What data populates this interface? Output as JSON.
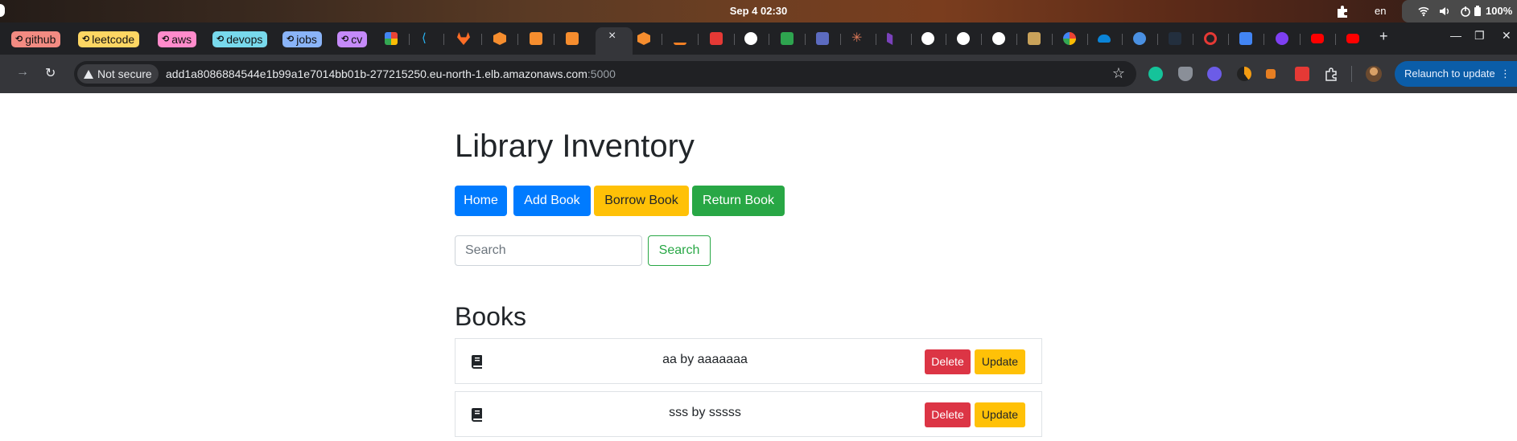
{
  "os": {
    "clock": "Sep 4  02:30",
    "lang": "en",
    "battery": "100%"
  },
  "tabs": {
    "groups": [
      {
        "label": "github",
        "color": "#f28b82"
      },
      {
        "label": "leetcode",
        "color": "#fdd663"
      },
      {
        "label": "aws",
        "color": "#ff8bcb"
      },
      {
        "label": "devops",
        "color": "#78d9ec"
      },
      {
        "label": "jobs",
        "color": "#8ab4f8"
      },
      {
        "label": "cv",
        "color": "#c58af9"
      }
    ],
    "active_close": "×",
    "new_tab": "+"
  },
  "toolbar": {
    "security_label": "Not secure",
    "url_host": "add1a8086884544e1b99a1e7014bb01b-277215250.eu-north-1.elb.amazonaws.com",
    "url_port": ":5000",
    "relaunch_label": "Relaunch to update"
  },
  "page": {
    "title": "Library Inventory",
    "nav": {
      "home": "Home",
      "add_book": "Add Book",
      "borrow_book": "Borrow Book",
      "return_book": "Return Book"
    },
    "search": {
      "placeholder": "Search",
      "button": "Search"
    },
    "books_heading": "Books",
    "books": [
      {
        "label": "aa by aaaaaaa",
        "delete": "Delete",
        "update": "Update"
      },
      {
        "label": "sss by sssss",
        "delete": "Delete",
        "update": "Update"
      }
    ]
  }
}
